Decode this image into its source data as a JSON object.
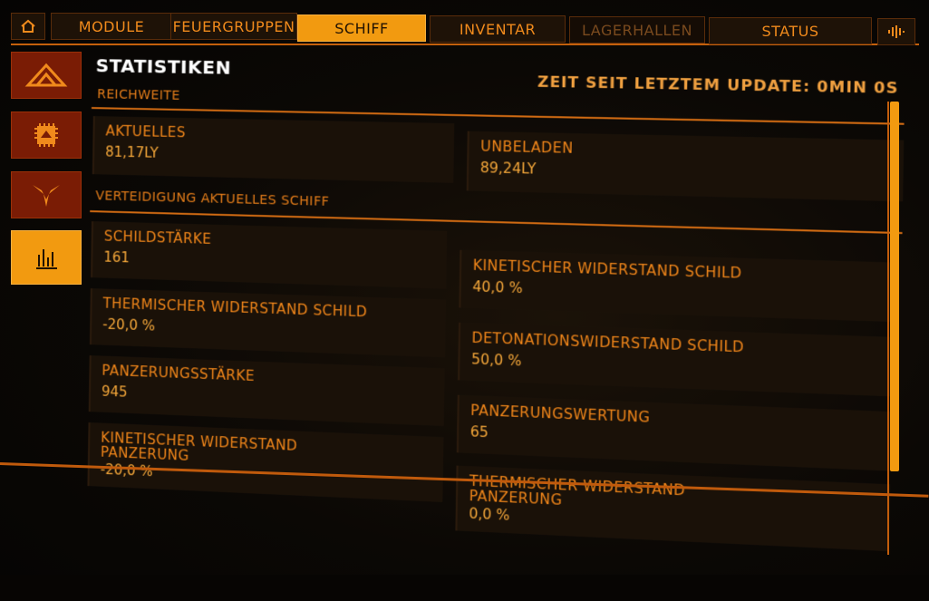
{
  "nav": {
    "tabs": [
      {
        "label": "MODULE"
      },
      {
        "label": "FEUERGRUPPEN"
      },
      {
        "label": "SCHIFF"
      },
      {
        "label": "INVENTAR"
      },
      {
        "label": "LAGERHALLEN"
      },
      {
        "label": "STATUS"
      }
    ],
    "active_tab": "SCHIFF"
  },
  "side": {
    "icons": [
      "ship-outline-icon",
      "module-chip-icon",
      "wings-emblem-icon",
      "stats-bars-icon"
    ],
    "active_index": 3
  },
  "header": {
    "title": "STATISTIKEN",
    "update": "ZEIT SEIT LETZTEM UPDATE: 0MIN 0S"
  },
  "range": {
    "section": "REICHWEITE",
    "current": {
      "label": "AKTUELLES",
      "value": "81,17LY"
    },
    "unladen": {
      "label": "UNBELADEN",
      "value": "89,24LY"
    }
  },
  "defense": {
    "section": "VERTEIDIGUNG AKTUELLES SCHIFF",
    "items": [
      {
        "label": "SCHILDSTÄRKE",
        "value": "161"
      },
      {
        "label": "KINETISCHER WIDERSTAND SCHILD",
        "value": "40,0 %"
      },
      {
        "label": "THERMISCHER WIDERSTAND SCHILD",
        "value": "-20,0 %"
      },
      {
        "label": "DETONATIONSWIDERSTAND SCHILD",
        "value": "50,0 %"
      },
      {
        "label": "PANZERUNGSSTÄRKE",
        "value": "945"
      },
      {
        "label": "PANZERUNGSWERTUNG",
        "value": "65"
      },
      {
        "label": "KINETISCHER WIDERSTAND PANZERUNG",
        "value": "-20,0 %"
      },
      {
        "label": "THERMISCHER WIDERSTAND PANZERUNG",
        "value": "0,0 %"
      }
    ]
  },
  "colors": {
    "accent": "#f29a10",
    "text": "#f08a1c",
    "side": "#7a1c05"
  }
}
